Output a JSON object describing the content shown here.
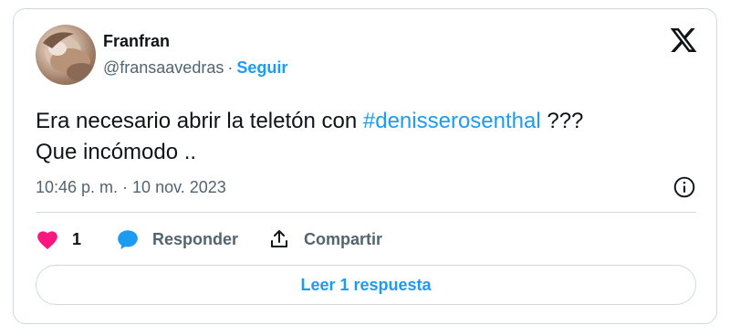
{
  "author": {
    "display_name": "Franfran",
    "handle": "@fransaavedras",
    "separator": "·",
    "follow_label": "Seguir"
  },
  "tweet": {
    "text_before": "Era necesario abrir la teletón con ",
    "hashtag": "#denisserosenthal",
    "text_after": " ???",
    "line2": "Que incómodo ..",
    "timestamp": "10:46 p. m. · 10 nov. 2023"
  },
  "actions": {
    "like_count": "1",
    "reply_label": "Responder",
    "share_label": "Compartir"
  },
  "read_replies_label": "Leer 1 respuesta",
  "icons": {
    "brand": "x-logo-icon",
    "info": "info-icon",
    "like": "heart-icon",
    "reply": "speech-bubble-icon",
    "share": "share-icon"
  },
  "colors": {
    "accent": "#1d9bf0",
    "like": "#f91880",
    "text_primary": "#0f1419",
    "text_secondary": "#536471",
    "border": "#cfd9de"
  }
}
